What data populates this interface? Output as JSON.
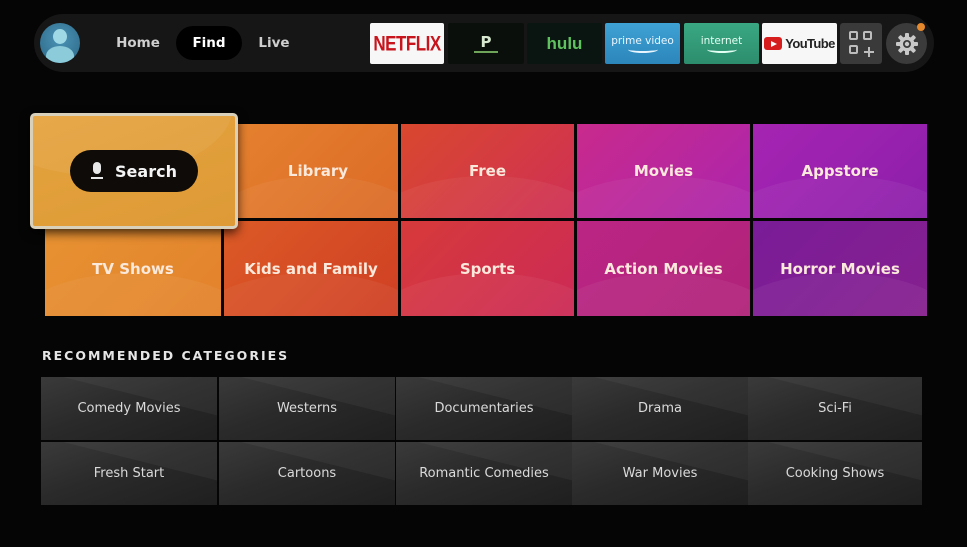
{
  "header": {
    "profile": {
      "icon": "user-avatar-icon"
    },
    "nav": [
      {
        "label": "Home",
        "active": false
      },
      {
        "label": "Find",
        "active": true
      },
      {
        "label": "Live",
        "active": false
      }
    ],
    "apps": [
      {
        "name": "Netflix",
        "label": "NETFLIX",
        "color": "#c8141c"
      },
      {
        "name": "P app",
        "label": "P"
      },
      {
        "name": "Hulu",
        "label": "hulu",
        "color": "#5fc25e"
      },
      {
        "name": "Prime Video",
        "label": "prime video",
        "color": "#3fa2d4"
      },
      {
        "name": "Internet",
        "label": "internet",
        "color": "#3aa883"
      },
      {
        "name": "YouTube",
        "label": "YouTube",
        "color": "#d71e1e"
      }
    ],
    "apps_grid_icon": "apps-grid-add-icon",
    "settings_icon": "gear-icon",
    "notification_color": "#e6892c"
  },
  "main_tiles": {
    "search": {
      "label": "Search",
      "icon": "microphone-icon",
      "focused": true
    },
    "tiles": [
      {
        "label": "Library",
        "color": "#e2742a"
      },
      {
        "label": "Free",
        "color": "#d8413a"
      },
      {
        "label": "Movies",
        "color": "#c52a96"
      },
      {
        "label": "Appstore",
        "color": "#9d22b0"
      },
      {
        "label": "TV Shows",
        "color": "#e68a30"
      },
      {
        "label": "Kids and Family",
        "color": "#d95126"
      },
      {
        "label": "Sports",
        "color": "#d1324a"
      },
      {
        "label": "Action Movies",
        "color": "#b92482"
      },
      {
        "label": "Horror Movies",
        "color": "#7f1c96"
      }
    ]
  },
  "recommended": {
    "title": "RECOMMENDED CATEGORIES",
    "items": [
      "Comedy Movies",
      "Westerns",
      "Documentaries",
      "Drama",
      "Sci-Fi",
      "Fresh Start",
      "Cartoons",
      "Romantic Comedies",
      "War Movies",
      "Cooking Shows"
    ]
  }
}
